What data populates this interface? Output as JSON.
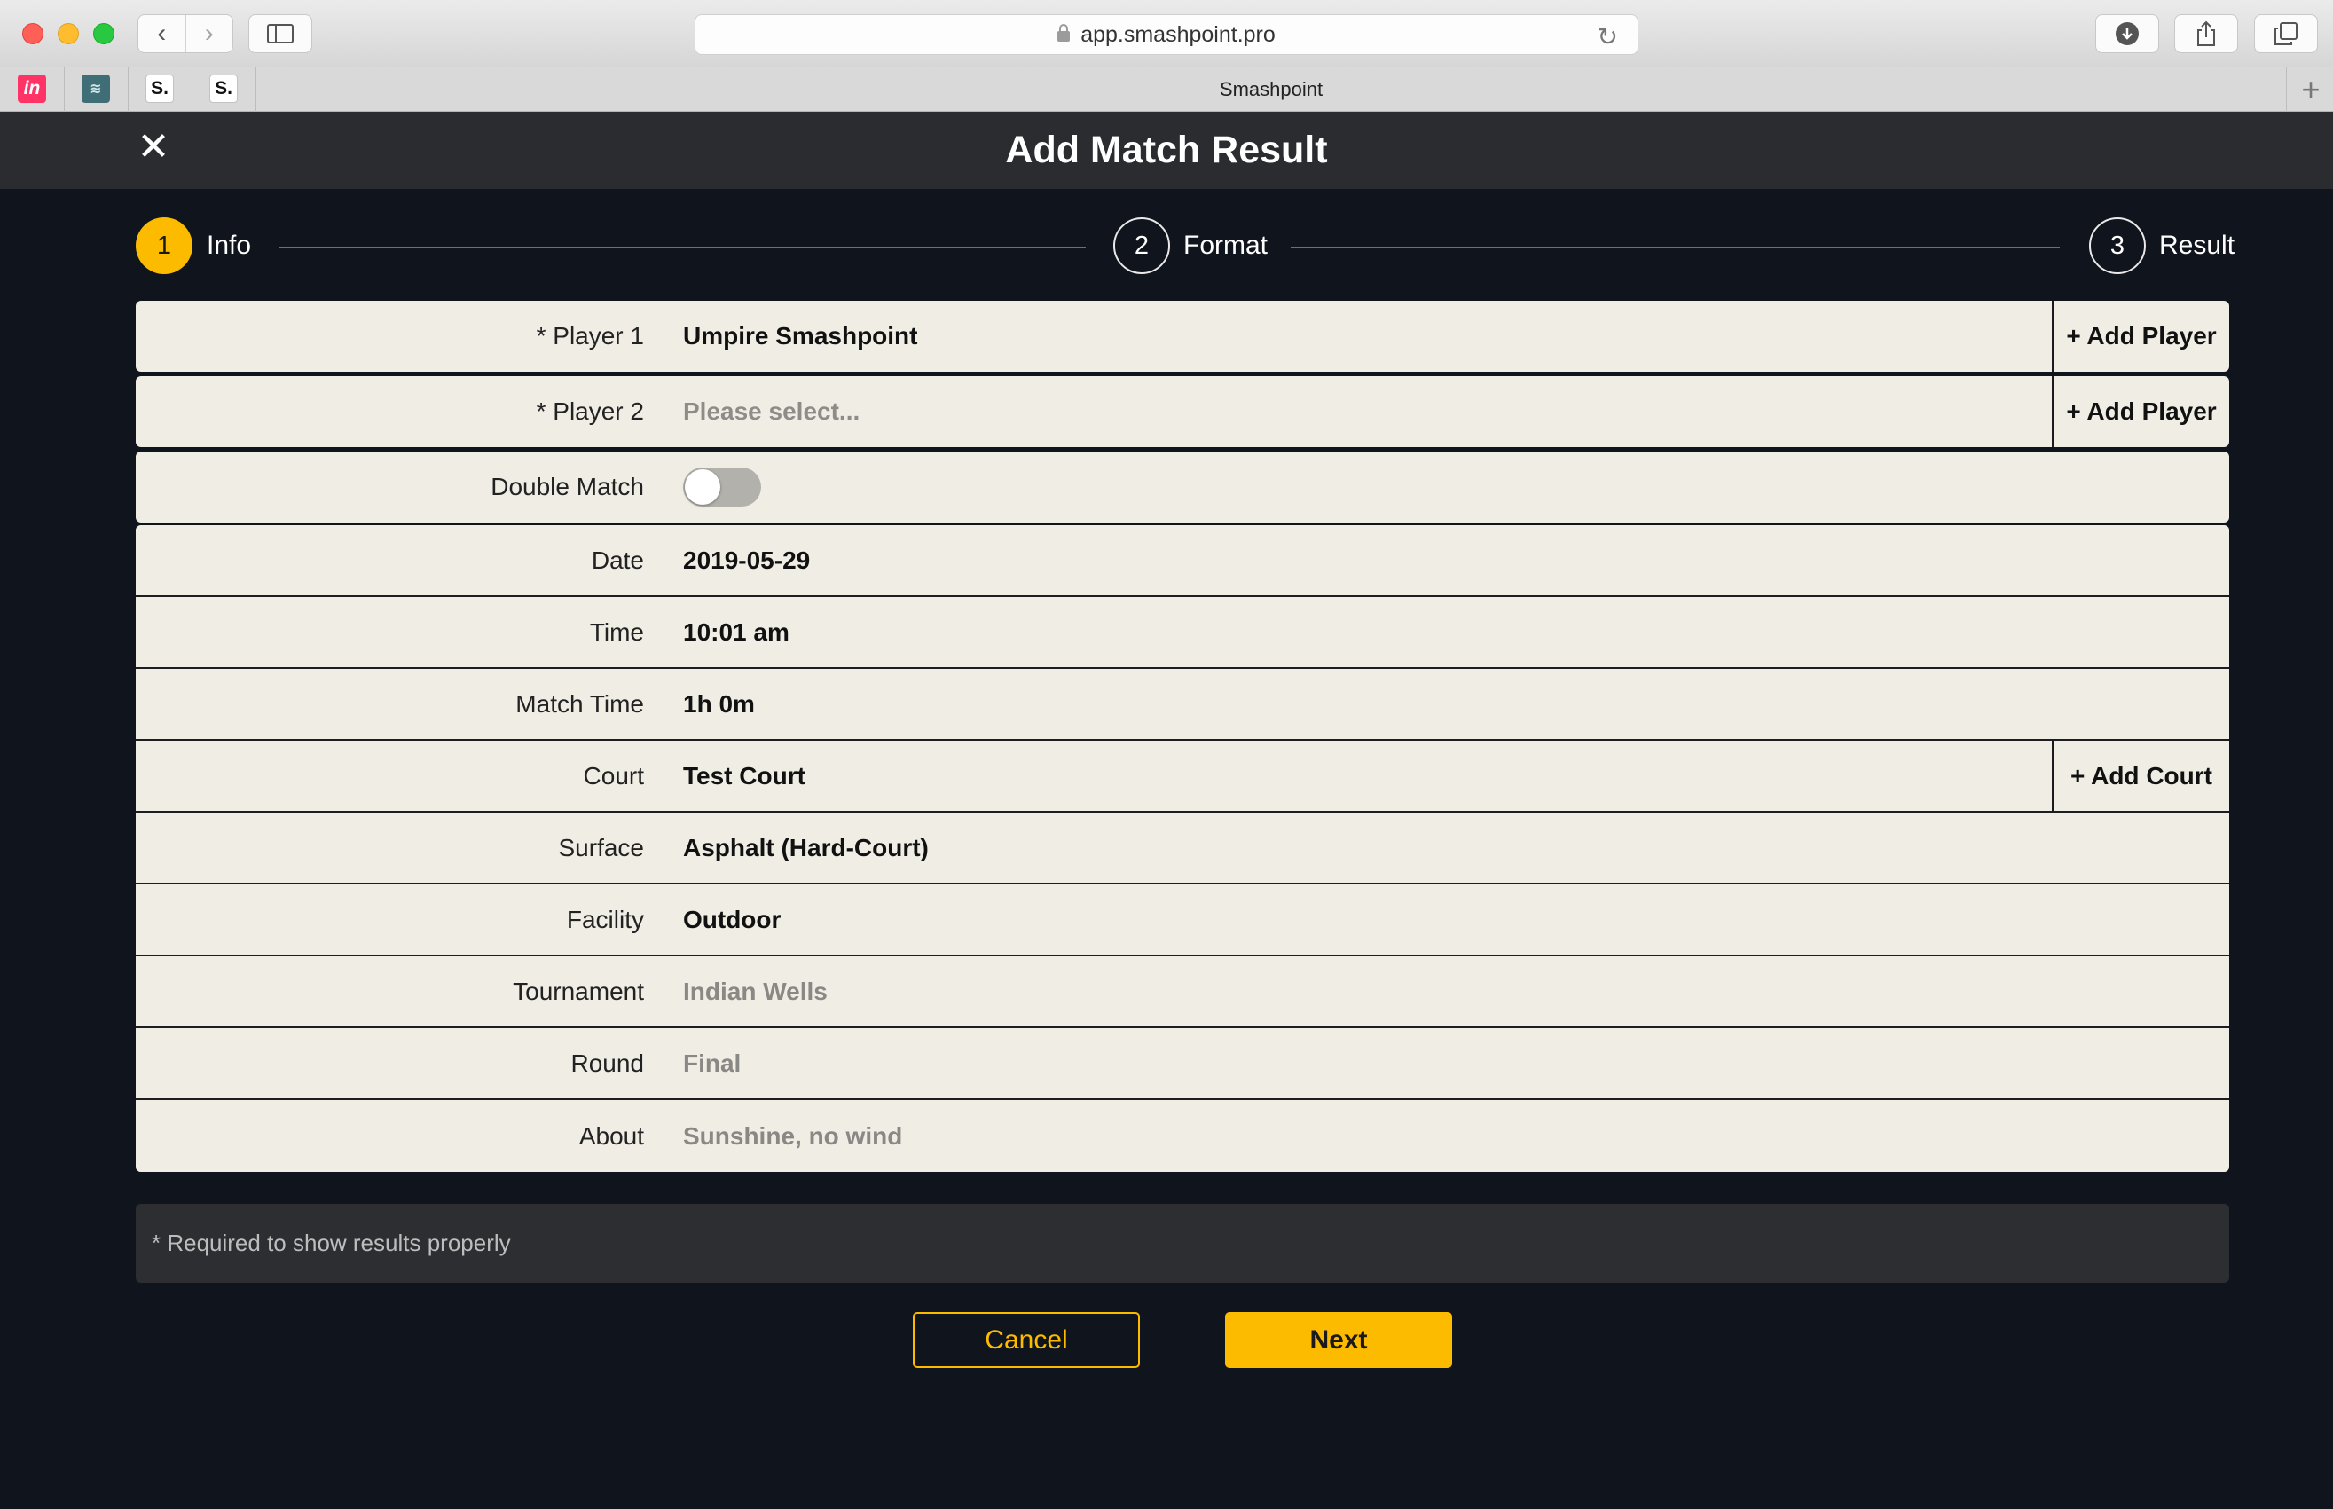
{
  "browser": {
    "url": "app.smashpoint.pro",
    "tab_title": "Smashpoint",
    "favicons": [
      {
        "name": "invision",
        "glyph": "in"
      },
      {
        "name": "bird-app",
        "glyph": "≋"
      },
      {
        "name": "smashpoint-1",
        "glyph": "S."
      },
      {
        "name": "smashpoint-2",
        "glyph": "S."
      }
    ]
  },
  "header": {
    "title": "Add Match Result"
  },
  "stepper": {
    "steps": [
      {
        "number": "1",
        "label": "Info",
        "active": true
      },
      {
        "number": "2",
        "label": "Format",
        "active": false
      },
      {
        "number": "3",
        "label": "Result",
        "active": false
      }
    ]
  },
  "form": {
    "player1": {
      "label": "* Player 1",
      "value": "Umpire Smashpoint",
      "add_label": "+ Add Player"
    },
    "player2": {
      "label": "* Player 2",
      "placeholder": "Please select...",
      "add_label": "+ Add Player"
    },
    "double_match": {
      "label": "Double Match",
      "enabled": false
    },
    "date": {
      "label": "Date",
      "value": "2019-05-29"
    },
    "time": {
      "label": "Time",
      "value": "10:01 am"
    },
    "match_time": {
      "label": "Match Time",
      "value": "1h 0m"
    },
    "court": {
      "label": "Court",
      "value": "Test Court",
      "add_label": "+ Add Court"
    },
    "surface": {
      "label": "Surface",
      "value": "Asphalt (Hard-Court)"
    },
    "facility": {
      "label": "Facility",
      "value": "Outdoor"
    },
    "tournament": {
      "label": "Tournament",
      "placeholder": "Indian Wells"
    },
    "round": {
      "label": "Round",
      "placeholder": "Final"
    },
    "about": {
      "label": "About",
      "placeholder": "Sunshine, no wind"
    }
  },
  "note": "* Required to show results properly",
  "actions": {
    "cancel_label": "Cancel",
    "next_label": "Next"
  },
  "colors": {
    "accent": "#fdbb00",
    "background": "#10141c",
    "header": "#2b2c30",
    "row": "#f0ede5"
  }
}
